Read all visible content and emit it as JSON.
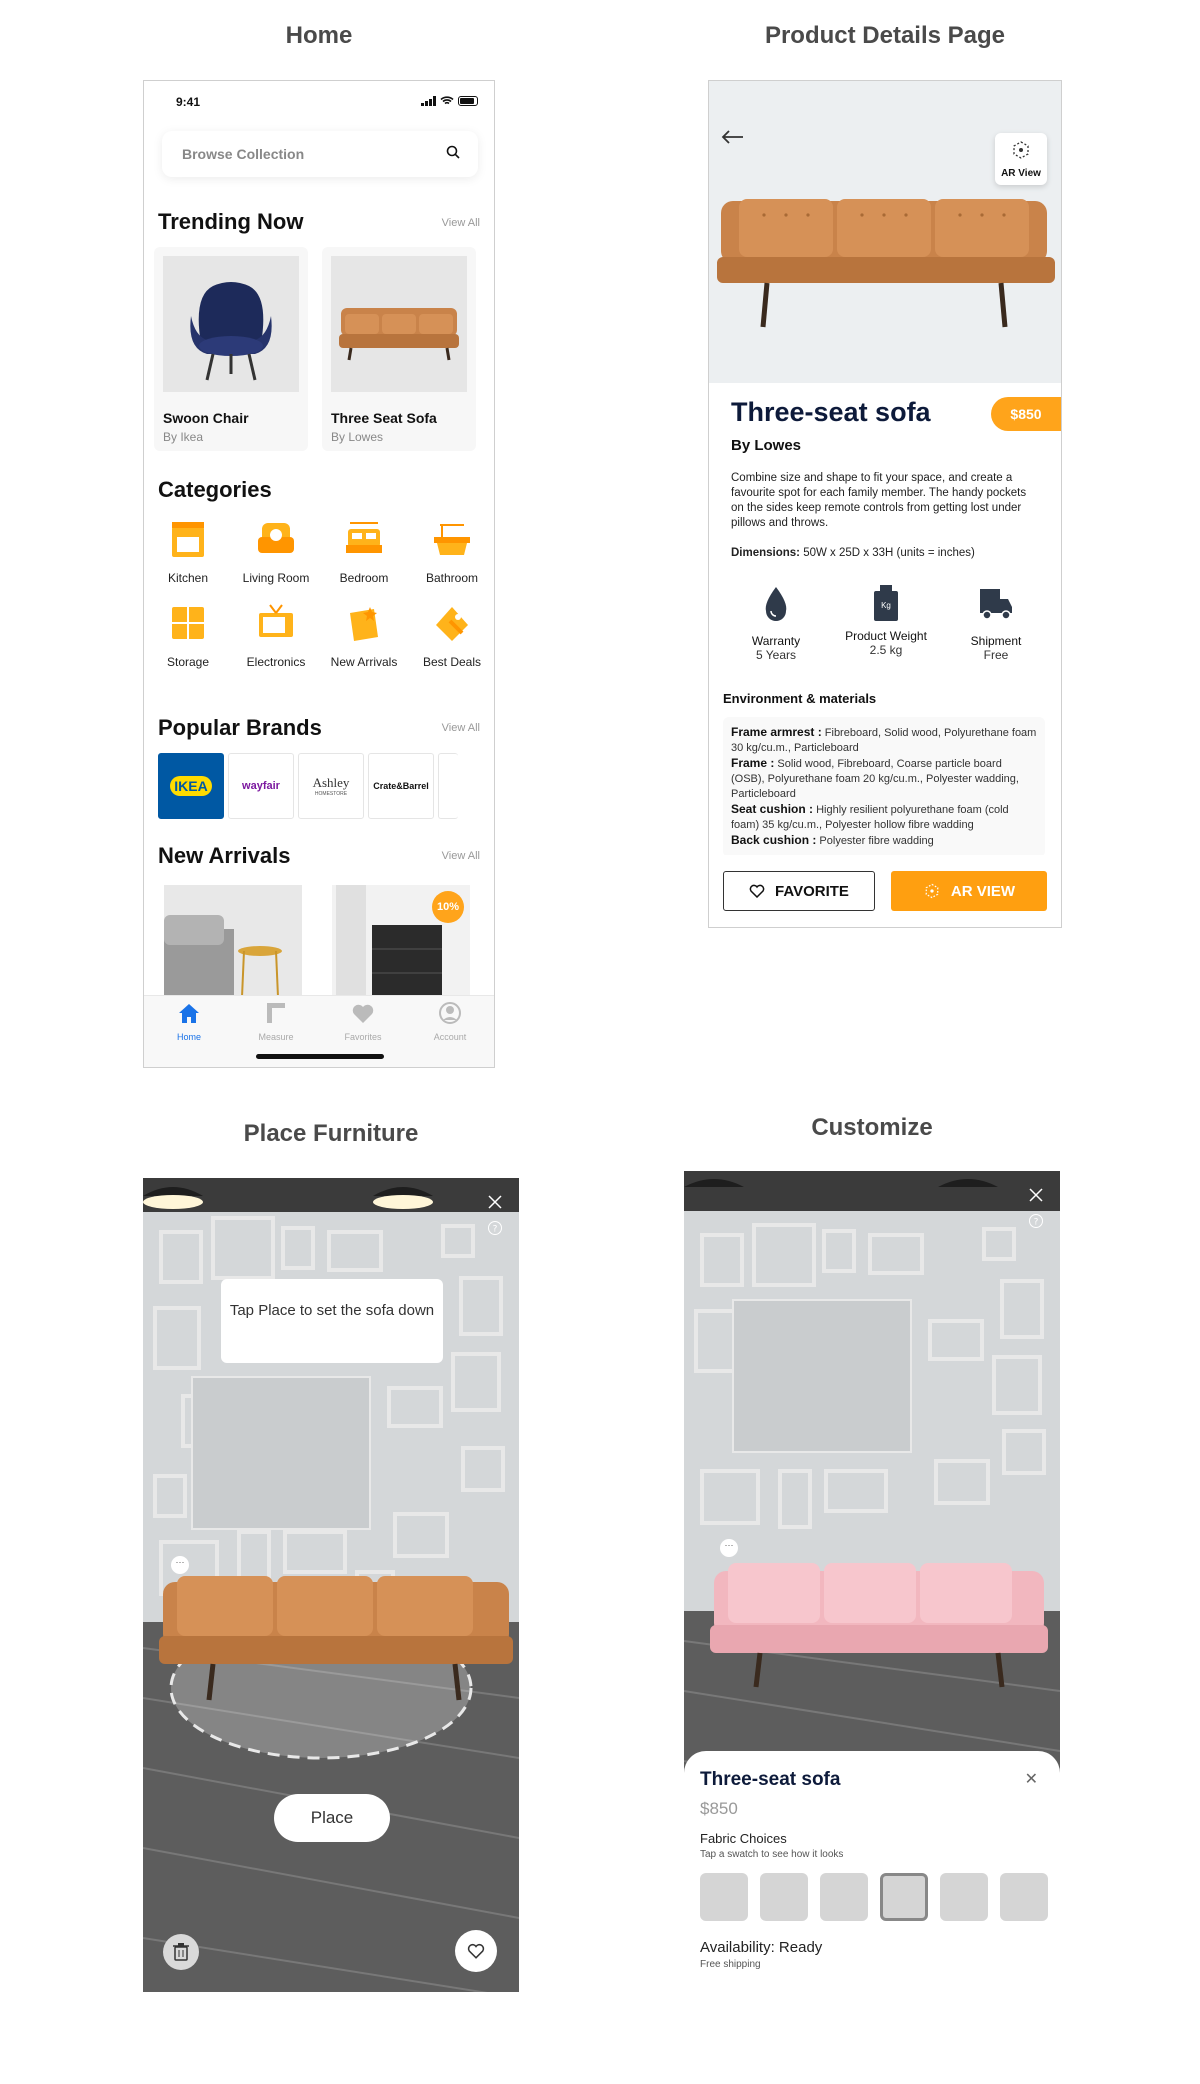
{
  "sections": {
    "home": "Home",
    "pdp": "Product Details Page",
    "place": "Place Furniture",
    "custom": "Customize"
  },
  "status": {
    "time": "9:41"
  },
  "home": {
    "search_placeholder": "Browse Collection",
    "trending": {
      "title": "Trending Now",
      "view_all": "View All",
      "items": [
        {
          "name": "Swoon Chair",
          "by": "By Ikea"
        },
        {
          "name": "Three Seat Sofa",
          "by": "By Lowes"
        }
      ]
    },
    "categories": {
      "title": "Categories",
      "items": [
        {
          "label": "Kitchen",
          "icon": "kitchen-icon"
        },
        {
          "label": "Living Room",
          "icon": "living-room-icon"
        },
        {
          "label": "Bedroom",
          "icon": "bedroom-icon"
        },
        {
          "label": "Bathroom",
          "icon": "bathroom-icon"
        },
        {
          "label": "Storage",
          "icon": "storage-icon"
        },
        {
          "label": "Electronics",
          "icon": "electronics-icon"
        },
        {
          "label": "New Arrivals",
          "icon": "new-arrivals-icon"
        },
        {
          "label": "Best Deals",
          "icon": "best-deals-icon"
        }
      ]
    },
    "brands": {
      "title": "Popular Brands",
      "view_all": "View All",
      "items": [
        "IKEA",
        "wayfair",
        "Ashley",
        "Crate&Barrel"
      ],
      "ashley_sub": "HOMESTORE"
    },
    "arrivals": {
      "title": "New Arrivals",
      "view_all": "View All",
      "badge": "10%"
    },
    "tabs": [
      {
        "label": "Home",
        "active": true
      },
      {
        "label": "Measure",
        "active": false
      },
      {
        "label": "Favorites",
        "active": false
      },
      {
        "label": "Account",
        "active": false
      }
    ]
  },
  "pdp": {
    "ar_label": "AR View",
    "title": "Three-seat sofa",
    "price": "$850",
    "brand": "By Lowes",
    "description": "Combine size and shape to fit your space, and create a favourite spot for each family member. The handy pockets on the sides keep remote controls from getting lost under pillows and throws.",
    "dimensions_label": "Dimensions:",
    "dimensions": " 50W x 25D x 33H (units = inches)",
    "features": [
      {
        "title": "Warranty",
        "value": "5 Years",
        "icon": "warranty-drop-icon"
      },
      {
        "title": "Product Weight",
        "value": "2.5 kg",
        "icon": "weight-icon",
        "icon_text": "Kg"
      },
      {
        "title": "Shipment",
        "value": "Free",
        "icon": "truck-icon"
      }
    ],
    "env_title": "Environment & materials",
    "materials": [
      {
        "label": "Frame armrest :",
        "text": " Fibreboard, Solid wood, Polyurethane foam 30 kg/cu.m., Particleboard"
      },
      {
        "label": "Frame :",
        "text": " Solid wood, Fibreboard, Coarse particle board (OSB), Polyurethane foam 20 kg/cu.m., Polyester wadding, Particleboard"
      },
      {
        "label": "Seat cushion :",
        "text": " Highly resilient polyurethane foam (cold foam) 35 kg/cu.m., Polyester hollow fibre wadding"
      },
      {
        "label": "Back cushion :",
        "text": " Polyester fibre wadding"
      }
    ],
    "favorite_label": "FAVORITE",
    "ar_button_label": "AR VIEW"
  },
  "place": {
    "tooltip": "Tap Place to set the sofa down",
    "place_label": "Place"
  },
  "custom": {
    "title": "Three-seat sofa",
    "price": "$850",
    "fabric_title": "Fabric Choices",
    "fabric_hint": "Tap a swatch to see how it looks",
    "availability": "Availability: Ready",
    "shipping": "Free shipping"
  },
  "colors": {
    "accent": "#ffa41b",
    "navy": "#0d1a3a",
    "sofa_tan": "#c9834a",
    "sofa_pink": "#f2b7bf",
    "tab_active": "#1a73e8"
  }
}
